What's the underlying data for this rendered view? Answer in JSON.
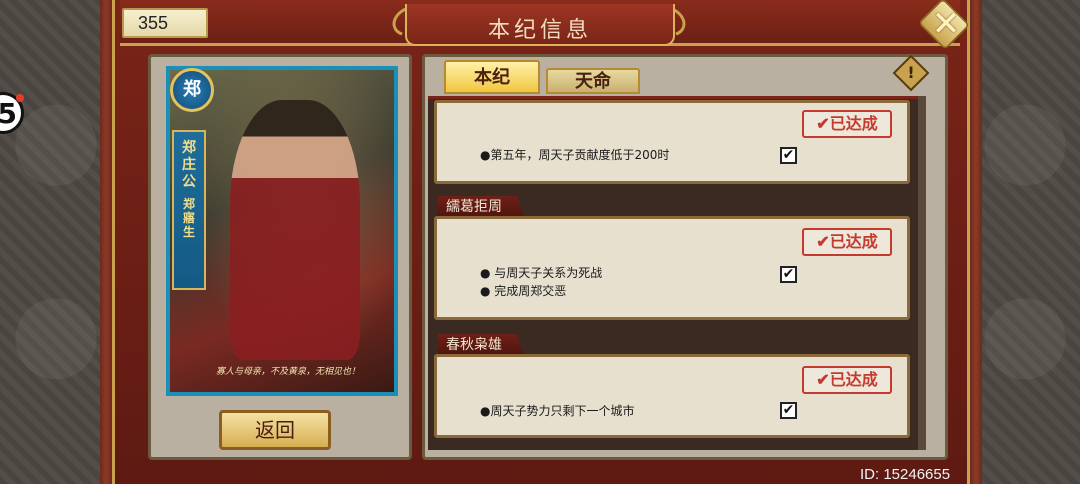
{
  "header": {
    "title": "本纪信息",
    "currency": "355",
    "close_icon_glyph": "✕"
  },
  "notification_badge": "5",
  "hero": {
    "seal_glyph": "郑",
    "name_vertical": "郑庄公",
    "rarity_vertical": "郑寤生",
    "quote": "寡人与母亲，不及黄泉，无相见也！"
  },
  "back_button": {
    "label": "返回"
  },
  "tabs": [
    {
      "label": "本纪",
      "active": true
    },
    {
      "label": "天命",
      "active": false
    }
  ],
  "info_icon_glyph": "!",
  "entries": [
    {
      "title": "",
      "status": "已达成",
      "conditions": [
        {
          "text": "●第五年，周天子贡献度低于200时",
          "checked": true
        }
      ]
    },
    {
      "title": "繻葛拒周",
      "status": "已达成",
      "conditions": [
        {
          "text": "●  与周天子关系为死战",
          "checked": true
        },
        {
          "text": "●  完成周郑交恶",
          "checked": false
        }
      ]
    },
    {
      "title": "春秋枭雄",
      "status": "已达成",
      "conditions": [
        {
          "text": "●周天子势力只剩下一个城市",
          "checked": true
        }
      ]
    }
  ],
  "check_glyph": "✔",
  "stamp_check_glyph": "✔",
  "footer": {
    "player_id": "ID: 15246655"
  },
  "colors": {
    "frame_red": "#7a2418",
    "gold": "#c9a24d",
    "stamp_red": "#c43a2e"
  }
}
